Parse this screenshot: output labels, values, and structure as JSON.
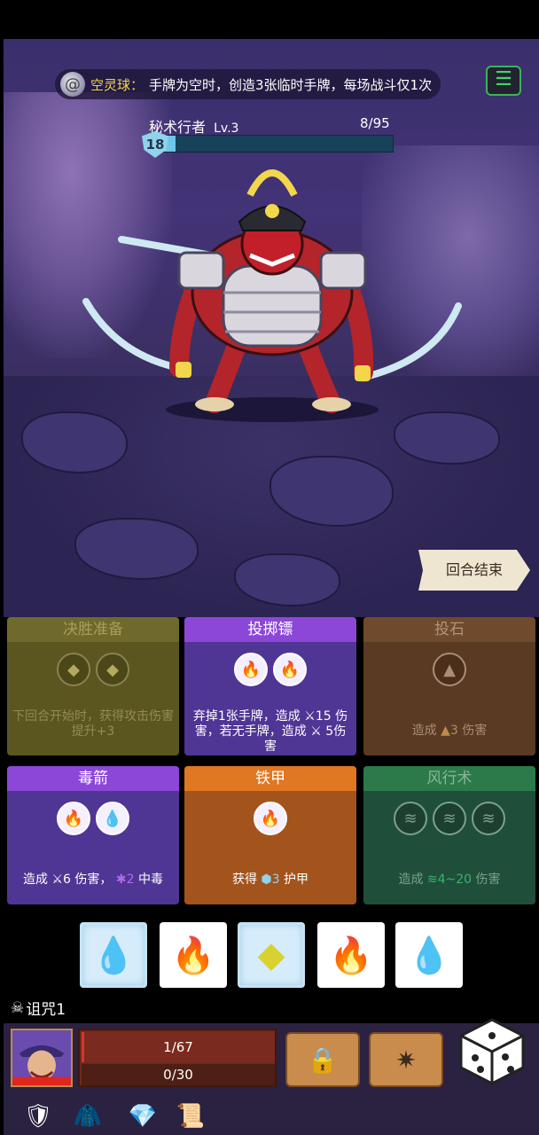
{
  "relic": {
    "icon": "spiral-orb-icon",
    "name": "空灵球：",
    "description": "手牌为空时，创造3张临时手牌，每场战斗仅1次"
  },
  "settings": {
    "icon": "settings-icon"
  },
  "enemy": {
    "name": "秘术行者",
    "level": "Lv.3",
    "hp_text": "8/95",
    "hp_current": 8,
    "hp_max": 95,
    "shield": "18",
    "figure": "samurai-monkey-warrior"
  },
  "end_turn": {
    "label": "回合结束"
  },
  "cards": [
    {
      "title": "决胜准备",
      "slots": [
        "yellow-diamond-icon",
        "grey-diamond-icon"
      ],
      "desc": "下回合开始时，获得攻击伤害提升+3",
      "state": "disabled",
      "color": "#6f6a2b"
    },
    {
      "title": "投掷镖",
      "slots": [
        "fire-icon",
        "fire-icon"
      ],
      "desc_parts": [
        "弃掉1张手牌，造成",
        "15",
        "伤害，若无手牌，造成",
        "5",
        "伤害"
      ],
      "state": "active",
      "color": "#8c47d8"
    },
    {
      "title": "投石",
      "slots": [
        "stone-icon"
      ],
      "desc_parts": [
        "造成",
        "3",
        "伤害"
      ],
      "state": "disabled",
      "color": "#6f4a2d"
    },
    {
      "title": "毒箭",
      "slots": [
        "fire-icon",
        "water-icon"
      ],
      "desc_parts": [
        "造成",
        "6",
        "伤害，",
        "2",
        "中毒"
      ],
      "state": "active",
      "color": "#8c47d8"
    },
    {
      "title": "铁甲",
      "slots": [
        "fire-icon"
      ],
      "desc_parts": [
        "获得",
        "3",
        "护甲"
      ],
      "state": "active",
      "color": "#e07722"
    },
    {
      "title": "风行术",
      "slots": [
        "wind-icon",
        "wind-icon",
        "wind-icon"
      ],
      "desc_parts": [
        "造成",
        "4~20",
        "伤害"
      ],
      "state": "disabled",
      "color": "#2c7a4a"
    }
  ],
  "dice": [
    {
      "icon": "water-drop-icon",
      "frozen": true
    },
    {
      "icon": "fire-icon",
      "frozen": false
    },
    {
      "icon": "yellow-diamond-icon",
      "frozen": true
    },
    {
      "icon": "fire-icon",
      "frozen": false
    },
    {
      "icon": "water-drop-icon",
      "frozen": false
    }
  ],
  "curse": {
    "icon": "skull-icon",
    "label": "诅咒1"
  },
  "player": {
    "hp_text": "1/67",
    "hp_current": 1,
    "hp_max": 67,
    "armor_text": "0/30"
  },
  "actions": {
    "lock_icon": "lock-icon",
    "reroll_icon": "spread-icon",
    "dice_icon": "dice-icon"
  },
  "inventory": [
    "armor-shield-icon",
    "cape-icon",
    "gem-icon",
    "scroll-skull-icon"
  ],
  "colors": {
    "hp_fill": "#d8352a",
    "enemy_hp_fill": "#6ec7e6",
    "accent_gold": "#f2d64b"
  }
}
